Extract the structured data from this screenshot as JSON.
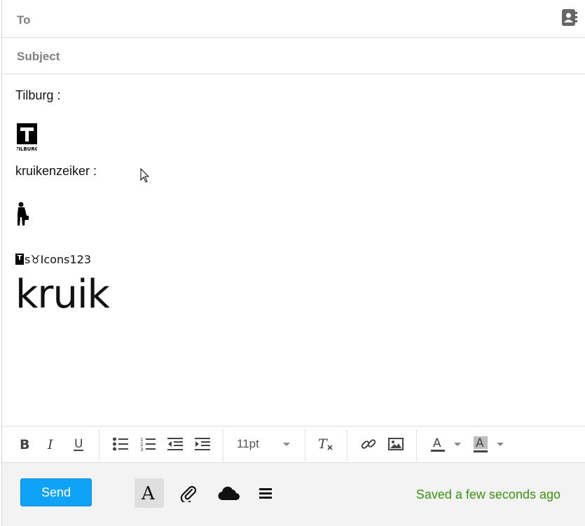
{
  "fields": {
    "to_label": "To",
    "subject_label": "Subject"
  },
  "body": {
    "line1": "Tilburg :",
    "line2": "kruikenzeiker :",
    "mini_t": "T",
    "mini_text": "s♉Icons123",
    "big_text": "kruik",
    "logo_letter": "T",
    "logo_caption": "TILBURG"
  },
  "toolbar": {
    "font_size": "11pt"
  },
  "footer": {
    "send_label": "Send",
    "status": "Saved a few seconds ago"
  },
  "colors": {
    "send_bg": "#0fa3f7",
    "status_green": "#3d8f12"
  },
  "icons": [
    "address-book-icon",
    "bold-icon",
    "italic-icon",
    "underline-icon",
    "bullet-list-icon",
    "numbered-list-icon",
    "outdent-icon",
    "indent-icon",
    "clear-format-icon",
    "link-icon",
    "image-icon",
    "text-color-icon",
    "background-color-icon",
    "font-icon",
    "attachment-icon",
    "cloud-icon",
    "menu-icon"
  ]
}
